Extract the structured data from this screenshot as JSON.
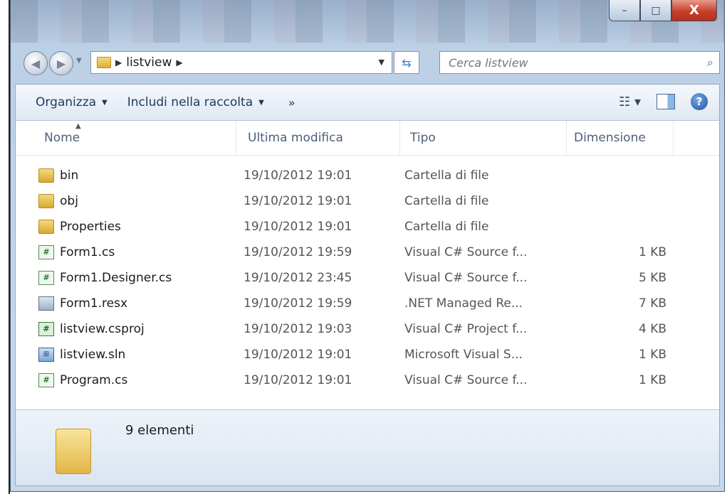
{
  "window": {
    "caption_buttons": {
      "minimize": "–",
      "maximize": "□",
      "close": "X"
    }
  },
  "address": {
    "breadcrumb": "listview",
    "search_placeholder": "Cerca listview"
  },
  "toolbar": {
    "organize": "Organizza",
    "include": "Includi nella raccolta",
    "more": "»"
  },
  "columns": {
    "name": "Nome",
    "modified": "Ultima modifica",
    "type": "Tipo",
    "size": "Dimensione"
  },
  "files": [
    {
      "name": "bin",
      "modified": "19/10/2012 19:01",
      "type": "Cartella di file",
      "size": "",
      "icon": "folder-icon"
    },
    {
      "name": "obj",
      "modified": "19/10/2012 19:01",
      "type": "Cartella di file",
      "size": "",
      "icon": "folder-icon"
    },
    {
      "name": "Properties",
      "modified": "19/10/2012 19:01",
      "type": "Cartella di file",
      "size": "",
      "icon": "folder-icon"
    },
    {
      "name": "Form1.cs",
      "modified": "19/10/2012 19:59",
      "type": "Visual C# Source f...",
      "size": "1 KB",
      "icon": "csharp-file-icon"
    },
    {
      "name": "Form1.Designer.cs",
      "modified": "19/10/2012 23:45",
      "type": "Visual C# Source f...",
      "size": "5 KB",
      "icon": "csharp-file-icon"
    },
    {
      "name": "Form1.resx",
      "modified": "19/10/2012 19:59",
      "type": ".NET Managed Re...",
      "size": "7 KB",
      "icon": "resx-file-icon"
    },
    {
      "name": "listview.csproj",
      "modified": "19/10/2012 19:03",
      "type": "Visual C# Project f...",
      "size": "4 KB",
      "icon": "csproj-file-icon"
    },
    {
      "name": "listview.sln",
      "modified": "19/10/2012 19:01",
      "type": "Microsoft Visual S...",
      "size": "1 KB",
      "icon": "sln-file-icon"
    },
    {
      "name": "Program.cs",
      "modified": "19/10/2012 19:01",
      "type": "Visual C# Source f...",
      "size": "1 KB",
      "icon": "csharp-file-icon"
    }
  ],
  "status": {
    "count": "9 elementi"
  }
}
